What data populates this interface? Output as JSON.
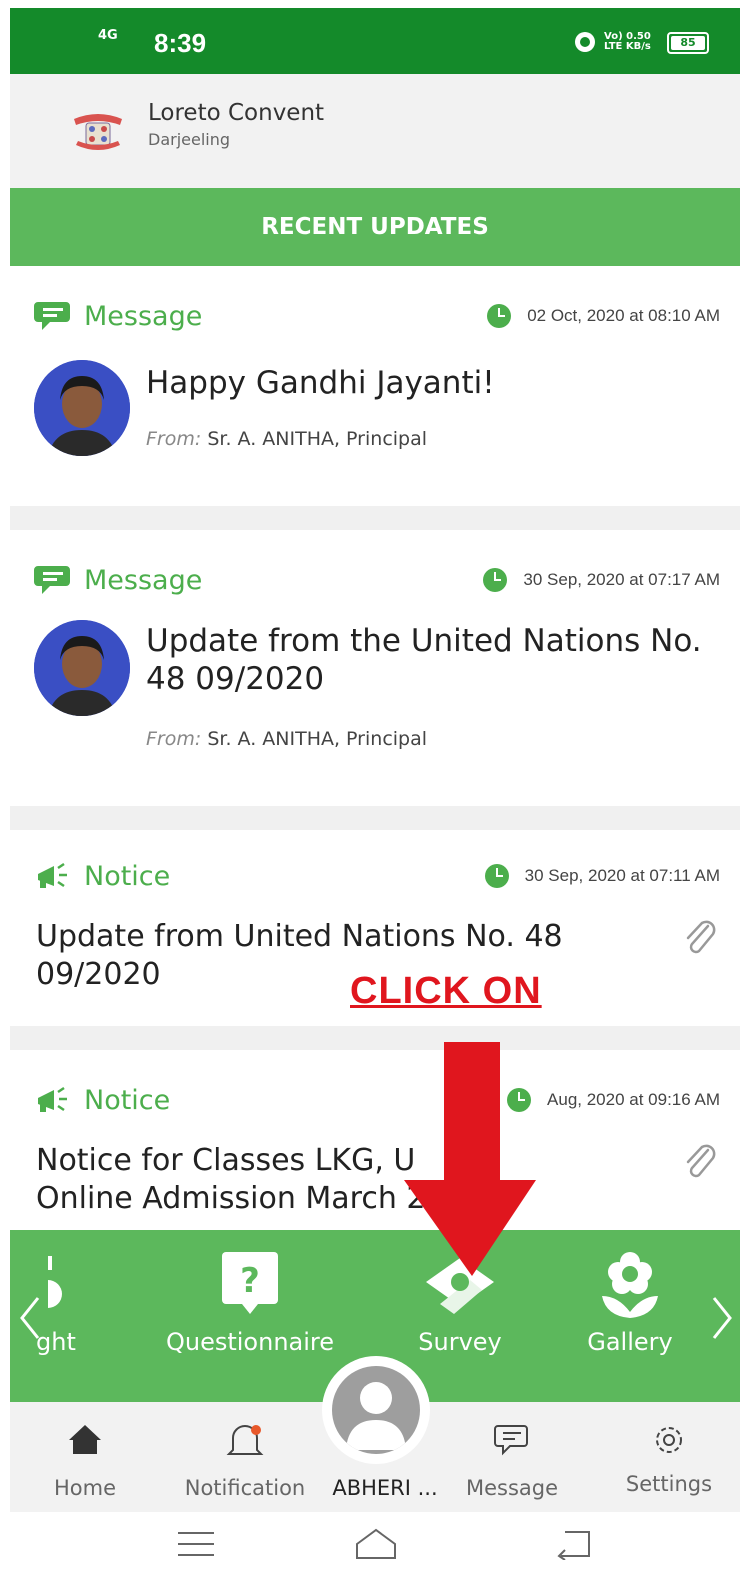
{
  "status_bar": {
    "signal": "4G",
    "time": "8:39",
    "net_top": "Vo) 0.50",
    "net_bottom": "LTE KB/s",
    "battery": "85",
    "colors": {
      "bar": "#148a2a"
    }
  },
  "header": {
    "school_name": "Loreto Convent",
    "city": "Darjeeling"
  },
  "banner": {
    "title": "RECENT UPDATES",
    "color": "#5cb85c"
  },
  "feed": [
    {
      "type": "Message",
      "time": "02 Oct, 2020 at 08:10 AM",
      "title": "Happy Gandhi Jayanti!",
      "from_label": "From:",
      "from": "Sr. A. ANITHA, Principal"
    },
    {
      "type": "Message",
      "time": "30 Sep, 2020 at 07:17 AM",
      "title": "Update from the United Nations No. 48 09/2020",
      "from_label": "From:",
      "from": "Sr. A. ANITHA, Principal"
    },
    {
      "type": "Notice",
      "time": "30 Sep, 2020 at 07:11 AM",
      "title": "Update from United Nations No. 48 09/2020"
    },
    {
      "type": "Notice",
      "time": "Aug, 2020 at 09:16 AM",
      "title": "Notice for Classes LKG, U      III Online Admission March 2"
    }
  ],
  "quick_menu": [
    {
      "label": "ght",
      "icon": "bulb-icon"
    },
    {
      "label": "Questionnaire",
      "icon": "question-icon"
    },
    {
      "label": "Survey",
      "icon": "survey-icon"
    },
    {
      "label": "Gallery",
      "icon": "flower-icon"
    }
  ],
  "bottom_nav": [
    {
      "label": "Home",
      "icon": "home-icon"
    },
    {
      "label": "Notification",
      "icon": "bell-icon"
    },
    {
      "label": "ABHERI ...",
      "icon": "profile-icon"
    },
    {
      "label": "Message",
      "icon": "chat-icon"
    },
    {
      "label": "Settings",
      "icon": "gear-icon"
    }
  ],
  "annotation": {
    "text": "CLICK ON",
    "color": "#e0161e"
  }
}
